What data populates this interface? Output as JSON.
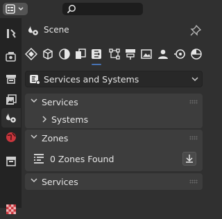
{
  "context": {
    "scene_label": "Scene"
  },
  "properties_tabs": [
    "tool-icon",
    "render-icon",
    "output-icon",
    "view-layer-icon",
    "scene-icon",
    "world-icon",
    "collection-icon",
    "texture-icon"
  ],
  "top_tabs": [
    "render-engine-icon",
    "cube-object-icon",
    "shading-sphere-icon",
    "copy-icon",
    "services-icon",
    "node-graph-icon",
    "render-stack-icon",
    "image-icon",
    "user-icon",
    "circle-dot-icon",
    "sphere-split-icon"
  ],
  "dropdown": {
    "label": "Services and Systems"
  },
  "panels": {
    "services": {
      "title": "Services",
      "child": "Systems"
    },
    "zones": {
      "title": "Zones",
      "status": "0 Zones Found"
    },
    "services2": {
      "title": "Services"
    }
  },
  "colors": {
    "accent": "#4772b3",
    "panel": "#3d3d3d",
    "tabbar": "#232323",
    "bg": "#303030"
  }
}
